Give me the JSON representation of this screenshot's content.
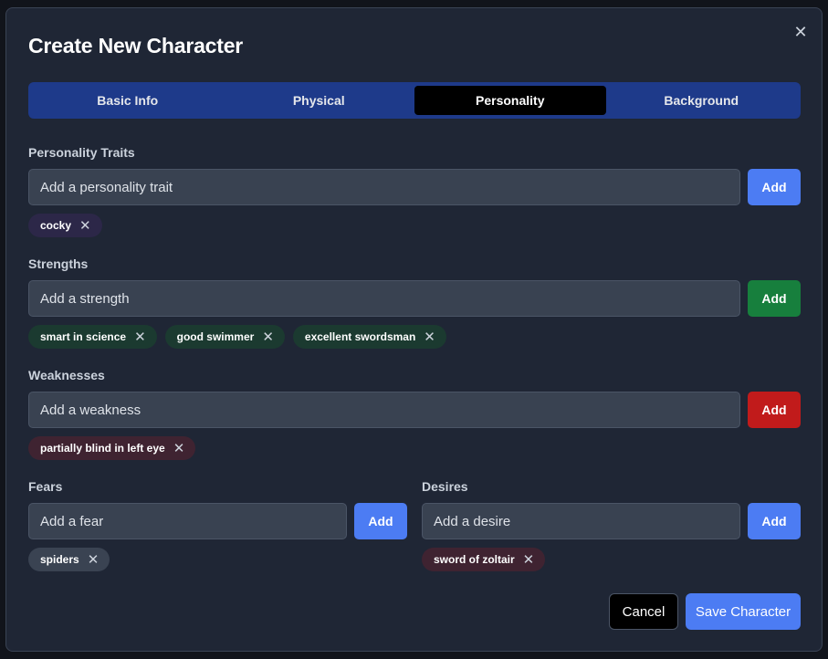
{
  "dialog": {
    "title": "Create New Character",
    "close_glyph": "✕"
  },
  "tabs": [
    {
      "label": "Basic Info",
      "active": false
    },
    {
      "label": "Physical",
      "active": false
    },
    {
      "label": "Personality",
      "active": true
    },
    {
      "label": "Background",
      "active": false
    }
  ],
  "traits": {
    "label": "Personality Traits",
    "placeholder": "Add a personality trait",
    "add_label": "Add",
    "tags": [
      "cocky"
    ]
  },
  "strengths": {
    "label": "Strengths",
    "placeholder": "Add a strength",
    "add_label": "Add",
    "tags": [
      "smart in science",
      "good swimmer",
      "excellent swordsman"
    ]
  },
  "weaknesses": {
    "label": "Weaknesses",
    "placeholder": "Add a weakness",
    "add_label": "Add",
    "tags": [
      "partially blind in left eye"
    ]
  },
  "fears": {
    "label": "Fears",
    "placeholder": "Add a fear",
    "add_label": "Add",
    "tags": [
      "spiders"
    ]
  },
  "desires": {
    "label": "Desires",
    "placeholder": "Add a desire",
    "add_label": "Add",
    "tags": [
      "sword of zoltair"
    ]
  },
  "footer": {
    "cancel_label": "Cancel",
    "save_label": "Save Character"
  },
  "tag_remove_glyph": "✕",
  "colors": {
    "accent_blue": "#4c7cf3",
    "accent_green": "#177f3d",
    "accent_red": "#c11b1b",
    "tab_bar": "#1e3a8a"
  }
}
